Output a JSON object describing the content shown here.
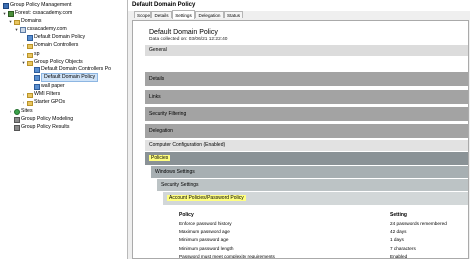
{
  "tree": {
    "items": [
      {
        "label": "Group Policy Management",
        "icon": "gpmc-icon",
        "expander": "",
        "level": 0
      },
      {
        "label": "Forest: cssacademy.com",
        "icon": "forest-icon",
        "expander": "▾",
        "level": 1
      },
      {
        "label": "Domains",
        "icon": "folder-icon",
        "expander": "▾",
        "level": 2
      },
      {
        "label": "cssacademy.com",
        "icon": "domain-icon",
        "expander": "▾",
        "level": 3
      },
      {
        "label": "Default Domain Policy",
        "icon": "gpo-link-icon",
        "expander": "",
        "level": 4
      },
      {
        "label": "Domain Controllers",
        "icon": "folder-icon",
        "expander": "›",
        "level": 4
      },
      {
        "label": "sp",
        "icon": "folder-icon",
        "expander": "›",
        "level": 4
      },
      {
        "label": "Group Policy Objects",
        "icon": "folder-icon",
        "expander": "▾",
        "level": 4
      },
      {
        "label": "Default Domain Controllers Po",
        "icon": "gpo-icon",
        "expander": "",
        "level": 5
      },
      {
        "label": "Default Domain Policy",
        "icon": "gpo-icon",
        "expander": "",
        "level": 5,
        "selected": true
      },
      {
        "label": "wall paper",
        "icon": "gpo-icon",
        "expander": "",
        "level": 5
      },
      {
        "label": "WMI Filters",
        "icon": "folder-icon",
        "expander": "›",
        "level": 4
      },
      {
        "label": "Starter GPOs",
        "icon": "folder-icon",
        "expander": "›",
        "level": 4
      },
      {
        "label": "Sites",
        "icon": "sites-icon",
        "expander": "›",
        "level": 2
      },
      {
        "label": "Group Policy Modeling",
        "icon": "modeling-icon",
        "expander": "",
        "level": 2
      },
      {
        "label": "Group Policy Results",
        "icon": "results-icon",
        "expander": "",
        "level": 2
      }
    ]
  },
  "header": {
    "title": "Default Domain Policy"
  },
  "tabs": [
    {
      "label": "Scope"
    },
    {
      "label": "Details"
    },
    {
      "label": "Settings",
      "active": true
    },
    {
      "label": "Delegation"
    },
    {
      "label": "Status"
    }
  ],
  "report": {
    "title": "Default Domain Policy",
    "data_collected": "Data collected on: 03/06/21 12:22:40",
    "general": "General",
    "sections": [
      "Details",
      "Links",
      "Security Filtering",
      "Delegation"
    ],
    "computer_config": "Computer Configuration (Enabled)",
    "policies": "Policies",
    "windows_settings": "Windows Settings",
    "security_settings": "Security Settings",
    "account_policies": "Account Policies/Password Policy",
    "table": {
      "headers": [
        "Policy",
        "Setting"
      ],
      "rows": [
        [
          "Enforce password history",
          "24 passwords remembered"
        ],
        [
          "Maximum password age",
          "42 days"
        ],
        [
          "Minimum password age",
          "1 days"
        ],
        [
          "Minimum password length",
          "7 characters"
        ],
        [
          "Password must meet complexity requirements",
          "Enabled"
        ],
        [
          "Store passwords using reversible encryption",
          "Disabled"
        ]
      ]
    }
  }
}
